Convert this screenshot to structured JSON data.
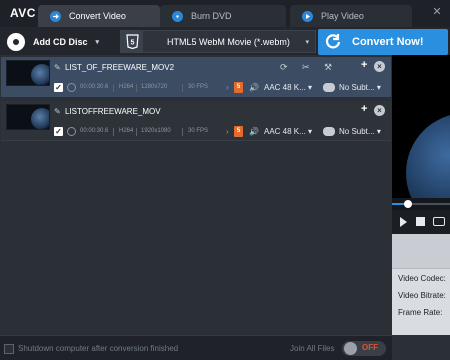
{
  "app": {
    "logo": "AVC",
    "close_glyph": "✕"
  },
  "tabs": [
    {
      "label": "Convert Video",
      "active": true
    },
    {
      "label": "Burn DVD",
      "active": false
    },
    {
      "label": "Play Video",
      "active": false
    }
  ],
  "toolbar": {
    "add_cd_label": "Add CD Disc",
    "format_label": "HTML5 WebM Movie (*.webm)",
    "convert_label": "Convert Now!",
    "caret": "▾"
  },
  "files": [
    {
      "name": "LIST_OF_FREEWARE_MOV2",
      "duration": "00:00:30.6",
      "codec": "H264",
      "resolution": "1280x720",
      "fps": "30 FPS",
      "audio": "AAC 48 K...",
      "subtitle": "No Subt...",
      "selected": true
    },
    {
      "name": "LISTOFFREEWARE_MOV",
      "duration": "00:00:30.6",
      "codec": "H264",
      "resolution": "1920x1080",
      "fps": "30 FPS",
      "audio": "AAC 48 K...",
      "subtitle": "No Subt...",
      "selected": false
    }
  ],
  "row_glyphs": {
    "pencil": "✎",
    "plus": "+",
    "close": "×",
    "check": "✓",
    "arrow": "›",
    "speaker": "🔊",
    "h5": "5",
    "refresh": "⟳",
    "cut": "✂",
    "tools": "⚒",
    "dropdown": "▾"
  },
  "bottom": {
    "shutdown_label": "Shutdown computer after conversion finished",
    "join_label": "Join All Files",
    "toggle_label": "OFF"
  },
  "info": {
    "video_codec_label": "Video Codec:",
    "video_bitrate_label": "Video Bitrate:",
    "frame_rate_label": "Frame Rate:"
  },
  "colors": {
    "accent": "#2b8fe0",
    "selected_row": "#3b4c63",
    "toggle_off": "#e2502f"
  }
}
